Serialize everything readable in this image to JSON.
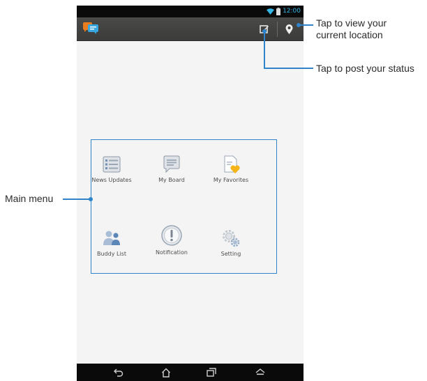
{
  "status_bar": {
    "time": "12:00",
    "icons": [
      "wifi-icon",
      "battery-icon"
    ]
  },
  "action_bar": {
    "logo_icon": "chat-bubbles-icon",
    "actions": [
      "post-status-icon",
      "location-pin-icon"
    ]
  },
  "main_menu": {
    "items": [
      {
        "label": "News Updates",
        "icon": "news-list-icon"
      },
      {
        "label": "My Board",
        "icon": "speech-bubble-icon"
      },
      {
        "label": "My Favorites",
        "icon": "favorites-document-heart-icon"
      },
      {
        "label": "Buddy List",
        "icon": "buddies-icon"
      },
      {
        "label": "Notification",
        "icon": "notification-exclamation-icon"
      },
      {
        "label": "Setting",
        "icon": "gears-icon"
      }
    ]
  },
  "nav_bar": {
    "buttons": [
      "back-icon",
      "home-icon",
      "recent-apps-icon",
      "menu-icon"
    ]
  },
  "annotations": {
    "location": "Tap to view your\ncurrent location",
    "post_status": "Tap to post your status",
    "main_menu": "Main menu"
  },
  "colors": {
    "annotation_accent": "#2f84c9",
    "status_time": "#33b5e5",
    "action_bar": "#40403e"
  }
}
